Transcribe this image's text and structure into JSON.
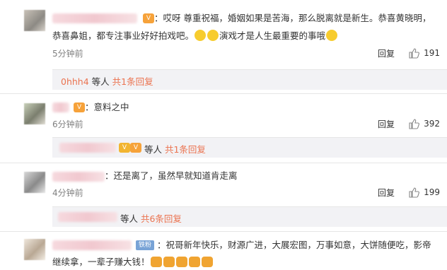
{
  "comments": [
    {
      "text_line1": "：哎呀 尊重祝福，婚姻如果是苦海，那么脱离就是新生。恭喜黄晓明，",
      "text_line2": "恭喜鼻姐，都专注事业好好拍戏吧。",
      "text_line2b": "演戏才是人生最重要的事哦",
      "time": "5分钟前",
      "reply": "回复",
      "likes": "191",
      "sub": {
        "user": "0hhh4",
        "middle": " 等人 ",
        "link": "共1条回复"
      }
    },
    {
      "text_line1": "：意料之中",
      "time": "6分钟前",
      "reply": "回复",
      "likes": "392",
      "sub": {
        "middle": "等人 ",
        "link": "共1条回复"
      }
    },
    {
      "text_line1": "：还是离了，虽然早就知道肯走离",
      "time": "4分钟前",
      "reply": "回复",
      "likes": "199",
      "sub": {
        "middle": "等人 ",
        "link": "共6条回复"
      }
    },
    {
      "tag": "铁粉",
      "text_line1": "：祝哥新年快乐，财源广进，大展宏图，万事如意，大饼随便吃，影帝",
      "text_line2": "继续拿，一辈子赚大钱！"
    }
  ],
  "icons": {
    "like": "thumbs-up-icon",
    "badge": "vip-badge-icon"
  }
}
